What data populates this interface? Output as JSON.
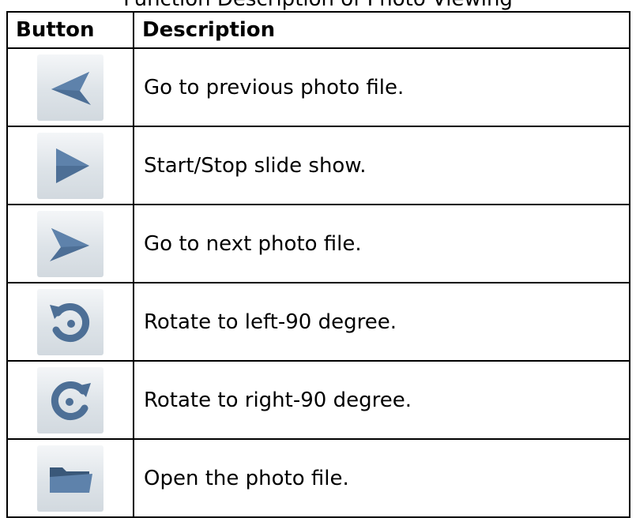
{
  "header_cutoff_text": "Function Description of Photo Viewing",
  "table": {
    "headers": {
      "button": "Button",
      "description": "Description"
    },
    "colors": {
      "icon_blue": "#4d6f96",
      "icon_blue_dark": "#3a5879",
      "tile_top": "#f4f6f8",
      "tile_bottom": "#d2d9df"
    },
    "rows": [
      {
        "icon": "previous-arrow-icon",
        "description": "Go to previous photo file."
      },
      {
        "icon": "play-icon",
        "description": "Start/Stop slide show."
      },
      {
        "icon": "next-arrow-icon",
        "description": "Go to next photo file."
      },
      {
        "icon": "rotate-left-icon",
        "description": "Rotate to left-90 degree."
      },
      {
        "icon": "rotate-right-icon",
        "description": "Rotate to right-90 degree."
      },
      {
        "icon": "open-folder-icon",
        "description": "Open the photo file."
      }
    ]
  }
}
